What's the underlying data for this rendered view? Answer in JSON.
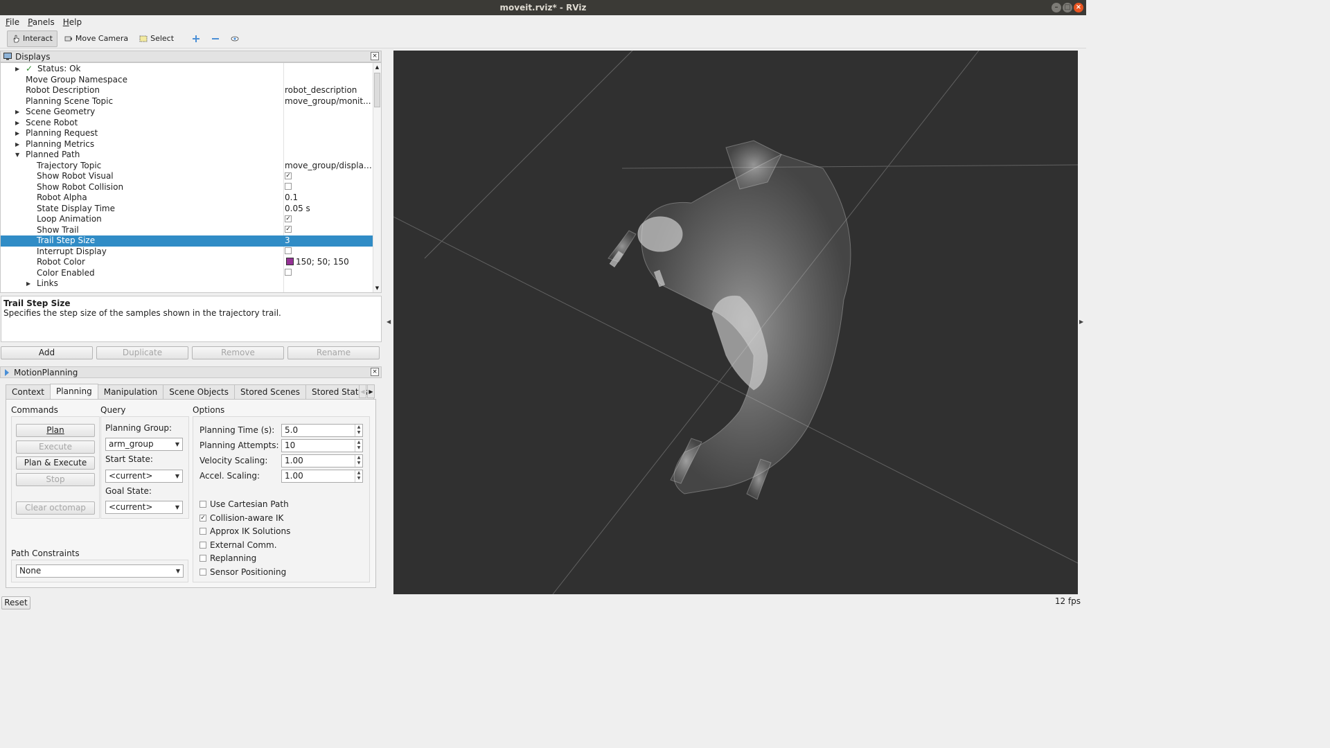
{
  "window": {
    "title": "moveit.rviz* - RViz"
  },
  "menu": [
    "File",
    "Panels",
    "Help"
  ],
  "toolbar": {
    "interact": "Interact",
    "move_camera": "Move Camera",
    "select": "Select"
  },
  "displays": {
    "title": "Displays",
    "rows": [
      {
        "name": "Status: Ok",
        "value": ""
      },
      {
        "name": "Move Group Namespace",
        "value": ""
      },
      {
        "name": "Robot Description",
        "value": "robot_description"
      },
      {
        "name": "Planning Scene Topic",
        "value": "move_group/monit..."
      },
      {
        "name": "Scene Geometry",
        "value": ""
      },
      {
        "name": "Scene Robot",
        "value": ""
      },
      {
        "name": "Planning Request",
        "value": ""
      },
      {
        "name": "Planning Metrics",
        "value": ""
      },
      {
        "name": "Planned Path",
        "value": ""
      },
      {
        "name": "Trajectory Topic",
        "value": "move_group/display..."
      },
      {
        "name": "Show Robot Visual",
        "value": ""
      },
      {
        "name": "Show Robot Collision",
        "value": ""
      },
      {
        "name": "Robot Alpha",
        "value": "0.1"
      },
      {
        "name": "State Display Time",
        "value": "0.05 s"
      },
      {
        "name": "Loop Animation",
        "value": ""
      },
      {
        "name": "Show Trail",
        "value": ""
      },
      {
        "name": "Trail Step Size",
        "value": "3"
      },
      {
        "name": "Interrupt Display",
        "value": ""
      },
      {
        "name": "Robot Color",
        "value": "150; 50; 150"
      },
      {
        "name": "Color Enabled",
        "value": ""
      },
      {
        "name": "Links",
        "value": ""
      }
    ],
    "robot_color_swatch": "#963296",
    "selection_color": "#308cc6",
    "description_title": "Trail Step Size",
    "description_text": "Specifies the step size of the samples shown in the trajectory trail.",
    "buttons": {
      "add": "Add",
      "duplicate": "Duplicate",
      "remove": "Remove",
      "rename": "Rename"
    }
  },
  "motion_planning": {
    "title": "MotionPlanning",
    "tabs": [
      "Context",
      "Planning",
      "Manipulation",
      "Scene Objects",
      "Stored Scenes",
      "Stored States"
    ],
    "commands": {
      "heading": "Commands",
      "plan": "Plan",
      "execute": "Execute",
      "plan_execute": "Plan & Execute",
      "stop": "Stop",
      "clear_octomap": "Clear octomap"
    },
    "query": {
      "heading": "Query",
      "planning_group_label": "Planning Group:",
      "planning_group": "arm_group",
      "start_state_label": "Start State:",
      "start_state": "<current>",
      "goal_state_label": "Goal State:",
      "goal_state": "<current>"
    },
    "options": {
      "heading": "Options",
      "planning_time_label": "Planning Time (s):",
      "planning_time": "5.0",
      "planning_attempts_label": "Planning Attempts:",
      "planning_attempts": "10",
      "velocity_scaling_label": "Velocity Scaling:",
      "velocity_scaling": "1.00",
      "accel_scaling_label": "Accel. Scaling:",
      "accel_scaling": "1.00",
      "use_cartesian_path": "Use Cartesian Path",
      "collision_aware_ik": "Collision-aware IK",
      "approx_ik": "Approx IK Solutions",
      "external_comm": "External Comm.",
      "replanning": "Replanning",
      "sensor_positioning": "Sensor Positioning"
    },
    "path_constraints": {
      "label": "Path Constraints",
      "value": "None"
    }
  },
  "reset": "Reset",
  "fps": "12 fps"
}
